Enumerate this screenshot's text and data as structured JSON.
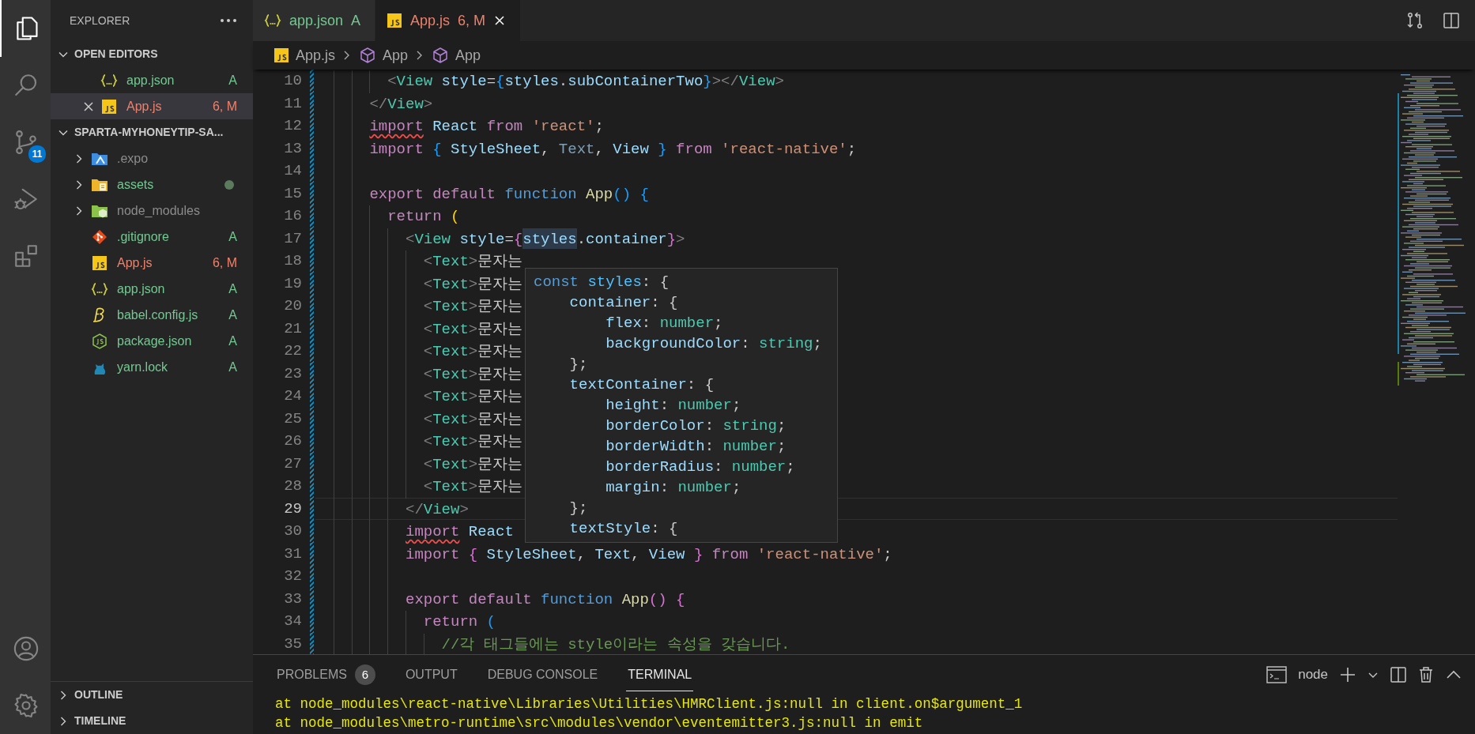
{
  "activity_bar": {
    "items": [
      {
        "kind": "explorer",
        "selected": true
      },
      {
        "kind": "search",
        "selected": false
      },
      {
        "kind": "source-control",
        "selected": false,
        "badge": "11"
      },
      {
        "kind": "run-debug",
        "selected": false
      },
      {
        "kind": "extensions",
        "selected": false
      }
    ],
    "bottom": [
      {
        "kind": "account"
      },
      {
        "kind": "settings"
      }
    ]
  },
  "sidebar": {
    "title": "EXPLORER",
    "open_editors": {
      "title": "OPEN EDITORS",
      "expanded": true,
      "items": [
        {
          "name": "app.json",
          "kind": "json",
          "color": "#73c991",
          "status": "A",
          "selected": false
        },
        {
          "name": "App.js",
          "kind": "js",
          "color": "#f0806a",
          "status": "6, M",
          "selected": true
        }
      ]
    },
    "folder": {
      "title": "SPARTA-MYHONEYTIP-SA...",
      "expanded": true,
      "items": [
        {
          "name": ".expo",
          "kind": "expo",
          "expanded": false,
          "color": "#8c8c8c"
        },
        {
          "name": "assets",
          "kind": "assets",
          "expanded": false,
          "color": "#73c991",
          "dot": true
        },
        {
          "name": "node_modules",
          "kind": "node",
          "expanded": false,
          "color": "#8c8c8c"
        },
        {
          "name": ".gitignore",
          "kind": "git",
          "color": "#73c991",
          "status": "A"
        },
        {
          "name": "App.js",
          "kind": "js",
          "color": "#f0806a",
          "status": "6, M"
        },
        {
          "name": "app.json",
          "kind": "json",
          "color": "#73c991",
          "status": "A"
        },
        {
          "name": "babel.config.js",
          "kind": "babel",
          "color": "#73c991",
          "status": "A"
        },
        {
          "name": "package.json",
          "kind": "nodejs",
          "color": "#73c991",
          "status": "A"
        },
        {
          "name": "yarn.lock",
          "kind": "yarn",
          "color": "#73c991",
          "status": "A"
        }
      ]
    },
    "bottom_sections": [
      {
        "title": "OUTLINE",
        "expanded": false
      },
      {
        "title": "TIMELINE",
        "expanded": false
      }
    ]
  },
  "editor": {
    "tabs": [
      {
        "label": "app.json",
        "kind": "json",
        "color": "#73c991",
        "status": "A",
        "selected": false
      },
      {
        "label": "App.js",
        "kind": "js",
        "color": "#f0806a",
        "status": "6, M",
        "selected": true
      }
    ],
    "breadcrumb": [
      {
        "label": "App.js",
        "kind": "js"
      },
      {
        "label": "App",
        "kind": "symbol"
      },
      {
        "label": "App",
        "kind": "symbol"
      }
    ],
    "lines": [
      {
        "number": "10",
        "current": false,
        "changed": true,
        "code": [
          {
            "text": "        <",
            "kind": "punct"
          },
          {
            "text": "View",
            "kind": "tag"
          },
          {
            "text": " style",
            "kind": "attr"
          },
          {
            "text": "=",
            "kind": "plain"
          },
          {
            "text": "{",
            "kind": "b3"
          },
          {
            "text": "styles",
            "kind": "var"
          },
          {
            "text": ".",
            "kind": "plain"
          },
          {
            "text": "subContainerTwo",
            "kind": "var"
          },
          {
            "text": "}",
            "kind": "b3"
          },
          {
            "text": "></",
            "kind": "punct"
          },
          {
            "text": "View",
            "kind": "tag"
          },
          {
            "text": ">",
            "kind": "punct"
          }
        ]
      },
      {
        "number": "11",
        "current": false,
        "changed": true,
        "code": [
          {
            "text": "      </",
            "kind": "punct"
          },
          {
            "text": "View",
            "kind": "tag"
          },
          {
            "text": ">",
            "kind": "punct"
          }
        ]
      },
      {
        "number": "12",
        "current": false,
        "changed": true,
        "code": [
          {
            "text": "      import",
            "kind": "kw-error"
          },
          {
            "text": " React",
            "kind": "var"
          },
          {
            "text": " from",
            "kind": "kw"
          },
          {
            "text": " 'react'",
            "kind": "str"
          },
          {
            "text": ";",
            "kind": "plain"
          }
        ]
      },
      {
        "number": "13",
        "current": false,
        "changed": true,
        "code": [
          {
            "text": "      import",
            "kind": "kw"
          },
          {
            "text": " {",
            "kind": "b3"
          },
          {
            "text": " StyleSheet",
            "kind": "var"
          },
          {
            "text": ",",
            "kind": "plain"
          },
          {
            "text": " Text",
            "kind": "dim"
          },
          {
            "text": ",",
            "kind": "plain"
          },
          {
            "text": " View",
            "kind": "var"
          },
          {
            "text": " }",
            "kind": "b3"
          },
          {
            "text": " from",
            "kind": "kw"
          },
          {
            "text": " 'react-native'",
            "kind": "str"
          },
          {
            "text": ";",
            "kind": "plain"
          }
        ]
      },
      {
        "number": "14",
        "current": false,
        "changed": true
      },
      {
        "number": "15",
        "current": false,
        "changed": true,
        "code": [
          {
            "text": "      export default",
            "kind": "kw"
          },
          {
            "text": " function",
            "kind": "storage"
          },
          {
            "text": " App",
            "kind": "fn"
          },
          {
            "text": "()",
            "kind": "b3"
          },
          {
            "text": " {",
            "kind": "b3"
          }
        ]
      },
      {
        "number": "16",
        "current": false,
        "changed": true,
        "code": [
          {
            "text": "        return",
            "kind": "kw"
          },
          {
            "text": " (",
            "kind": "b1"
          }
        ]
      },
      {
        "number": "17",
        "current": false,
        "changed": true,
        "code": [
          {
            "text": "          <",
            "kind": "punct"
          },
          {
            "text": "View",
            "kind": "tag"
          },
          {
            "text": " style",
            "kind": "attr"
          },
          {
            "text": "=",
            "kind": "plain"
          },
          {
            "text": "{",
            "kind": "b2"
          },
          {
            "text": "styles",
            "kind": "var-hover"
          },
          {
            "text": ".",
            "kind": "plain"
          },
          {
            "text": "container",
            "kind": "var"
          },
          {
            "text": "}",
            "kind": "b2"
          },
          {
            "text": ">",
            "kind": "punct"
          }
        ]
      },
      {
        "number": "18",
        "current": false,
        "changed": true,
        "code": [
          {
            "text": "            <",
            "kind": "punct"
          },
          {
            "text": "Text",
            "kind": "tag"
          },
          {
            "text": ">",
            "kind": "punct"
          },
          {
            "text": "문자는",
            "kind": "plain"
          }
        ]
      },
      {
        "number": "19",
        "current": false,
        "changed": true,
        "code": [
          {
            "text": "            <",
            "kind": "punct"
          },
          {
            "text": "Text",
            "kind": "tag"
          },
          {
            "text": ">",
            "kind": "punct"
          },
          {
            "text": "문자는",
            "kind": "plain"
          }
        ]
      },
      {
        "number": "20",
        "current": false,
        "changed": true,
        "code": [
          {
            "text": "            <",
            "kind": "punct"
          },
          {
            "text": "Text",
            "kind": "tag"
          },
          {
            "text": ">",
            "kind": "punct"
          },
          {
            "text": "문자는",
            "kind": "plain"
          }
        ]
      },
      {
        "number": "21",
        "current": false,
        "changed": true,
        "code": [
          {
            "text": "            <",
            "kind": "punct"
          },
          {
            "text": "Text",
            "kind": "tag"
          },
          {
            "text": ">",
            "kind": "punct"
          },
          {
            "text": "문자는",
            "kind": "plain"
          }
        ]
      },
      {
        "number": "22",
        "current": false,
        "changed": true,
        "code": [
          {
            "text": "            <",
            "kind": "punct"
          },
          {
            "text": "Text",
            "kind": "tag"
          },
          {
            "text": ">",
            "kind": "punct"
          },
          {
            "text": "문자는",
            "kind": "plain"
          }
        ]
      },
      {
        "number": "23",
        "current": false,
        "changed": true,
        "code": [
          {
            "text": "            <",
            "kind": "punct"
          },
          {
            "text": "Text",
            "kind": "tag"
          },
          {
            "text": ">",
            "kind": "punct"
          },
          {
            "text": "문자는",
            "kind": "plain"
          }
        ]
      },
      {
        "number": "24",
        "current": false,
        "changed": true,
        "code": [
          {
            "text": "            <",
            "kind": "punct"
          },
          {
            "text": "Text",
            "kind": "tag"
          },
          {
            "text": ">",
            "kind": "punct"
          },
          {
            "text": "문자는",
            "kind": "plain"
          }
        ]
      },
      {
        "number": "25",
        "current": false,
        "changed": true,
        "code": [
          {
            "text": "            <",
            "kind": "punct"
          },
          {
            "text": "Text",
            "kind": "tag"
          },
          {
            "text": ">",
            "kind": "punct"
          },
          {
            "text": "문자는",
            "kind": "plain"
          }
        ]
      },
      {
        "number": "26",
        "current": false,
        "changed": true,
        "code": [
          {
            "text": "            <",
            "kind": "punct"
          },
          {
            "text": "Text",
            "kind": "tag"
          },
          {
            "text": ">",
            "kind": "punct"
          },
          {
            "text": "문자는",
            "kind": "plain"
          }
        ]
      },
      {
        "number": "27",
        "current": false,
        "changed": true,
        "code": [
          {
            "text": "            <",
            "kind": "punct"
          },
          {
            "text": "Text",
            "kind": "tag"
          },
          {
            "text": ">",
            "kind": "punct"
          },
          {
            "text": "문자는",
            "kind": "plain"
          }
        ]
      },
      {
        "number": "28",
        "current": false,
        "changed": true,
        "code": [
          {
            "text": "            <",
            "kind": "punct"
          },
          {
            "text": "Text",
            "kind": "tag"
          },
          {
            "text": ">",
            "kind": "punct"
          },
          {
            "text": "문자는",
            "kind": "plain"
          }
        ]
      },
      {
        "number": "29",
        "current": true,
        "changed": true,
        "code": [
          {
            "text": "          </",
            "kind": "punct"
          },
          {
            "text": "View",
            "kind": "tag"
          },
          {
            "text": ">",
            "kind": "punct"
          }
        ]
      },
      {
        "number": "30",
        "current": false,
        "changed": true,
        "code": [
          {
            "text": "          import",
            "kind": "kw-error"
          },
          {
            "text": " React",
            "kind": "var"
          }
        ]
      },
      {
        "number": "31",
        "current": false,
        "changed": true,
        "code": [
          {
            "text": "          import",
            "kind": "kw"
          },
          {
            "text": " {",
            "kind": "b2"
          },
          {
            "text": " StyleSheet",
            "kind": "var"
          },
          {
            "text": ",",
            "kind": "plain"
          },
          {
            "text": " Text",
            "kind": "var"
          },
          {
            "text": ",",
            "kind": "plain"
          },
          {
            "text": " View",
            "kind": "var"
          },
          {
            "text": " }",
            "kind": "b2"
          },
          {
            "text": " from",
            "kind": "kw"
          },
          {
            "text": " 'react-native'",
            "kind": "str"
          },
          {
            "text": ";",
            "kind": "plain"
          }
        ]
      },
      {
        "number": "32",
        "current": false,
        "changed": true
      },
      {
        "number": "33",
        "current": false,
        "changed": true,
        "code": [
          {
            "text": "          export default",
            "kind": "kw"
          },
          {
            "text": " function",
            "kind": "storage"
          },
          {
            "text": " App",
            "kind": "fn"
          },
          {
            "text": "()",
            "kind": "b2"
          },
          {
            "text": " {",
            "kind": "b2"
          }
        ]
      },
      {
        "number": "34",
        "current": false,
        "changed": true,
        "code": [
          {
            "text": "            return",
            "kind": "kw"
          },
          {
            "text": " (",
            "kind": "b3"
          }
        ]
      },
      {
        "number": "35",
        "current": false,
        "changed": true,
        "code": [
          {
            "text": "              //각 태그들에는 style이라는 속성을 갖습니다.",
            "kind": "comment"
          }
        ]
      }
    ],
    "hover": {
      "lines": [
        {
          "code": [
            {
              "text": "const",
              "kind": "storage"
            },
            {
              "text": " styles",
              "kind": "const"
            },
            {
              "text": ": {",
              "kind": "plain"
            }
          ]
        },
        {
          "code": [
            {
              "text": "    container",
              "kind": "var"
            },
            {
              "text": ": {",
              "kind": "plain"
            }
          ]
        },
        {
          "code": [
            {
              "text": "        flex",
              "kind": "var"
            },
            {
              "text": ":",
              "kind": "plain"
            },
            {
              "text": " number",
              "kind": "type"
            },
            {
              "text": ";",
              "kind": "plain"
            }
          ]
        },
        {
          "code": [
            {
              "text": "        backgroundColor",
              "kind": "var"
            },
            {
              "text": ":",
              "kind": "plain"
            },
            {
              "text": " string",
              "kind": "type"
            },
            {
              "text": ";",
              "kind": "plain"
            }
          ]
        },
        {
          "code": [
            {
              "text": "    };",
              "kind": "plain"
            }
          ]
        },
        {
          "code": [
            {
              "text": "    textContainer",
              "kind": "var"
            },
            {
              "text": ": {",
              "kind": "plain"
            }
          ]
        },
        {
          "code": [
            {
              "text": "        height",
              "kind": "var"
            },
            {
              "text": ":",
              "kind": "plain"
            },
            {
              "text": " number",
              "kind": "type"
            },
            {
              "text": ";",
              "kind": "plain"
            }
          ]
        },
        {
          "code": [
            {
              "text": "        borderColor",
              "kind": "var"
            },
            {
              "text": ":",
              "kind": "plain"
            },
            {
              "text": " string",
              "kind": "type"
            },
            {
              "text": ";",
              "kind": "plain"
            }
          ]
        },
        {
          "code": [
            {
              "text": "        borderWidth",
              "kind": "var"
            },
            {
              "text": ":",
              "kind": "plain"
            },
            {
              "text": " number",
              "kind": "type"
            },
            {
              "text": ";",
              "kind": "plain"
            }
          ]
        },
        {
          "code": [
            {
              "text": "        borderRadius",
              "kind": "var"
            },
            {
              "text": ":",
              "kind": "plain"
            },
            {
              "text": " number",
              "kind": "type"
            },
            {
              "text": ";",
              "kind": "plain"
            }
          ]
        },
        {
          "code": [
            {
              "text": "        margin",
              "kind": "var"
            },
            {
              "text": ":",
              "kind": "plain"
            },
            {
              "text": " number",
              "kind": "type"
            },
            {
              "text": ";",
              "kind": "plain"
            }
          ]
        },
        {
          "code": [
            {
              "text": "    };",
              "kind": "plain"
            }
          ]
        },
        {
          "code": [
            {
              "text": "    textStyle",
              "kind": "var"
            },
            {
              "text": ": {",
              "kind": "plain"
            }
          ]
        }
      ]
    }
  },
  "panel": {
    "tabs": [
      {
        "label": "PROBLEMS",
        "count": "6",
        "selected": false
      },
      {
        "label": "OUTPUT",
        "selected": false
      },
      {
        "label": "DEBUG CONSOLE",
        "selected": false
      },
      {
        "label": "TERMINAL",
        "selected": true
      }
    ],
    "shell": "node",
    "terminal_lines": [
      "at node_modules\\react-native\\Libraries\\Utilities\\HMRClient.js:null in client.on$argument_1",
      "at node_modules\\metro-runtime\\src\\modules\\vendor\\eventemitter3.js:null in emit"
    ]
  }
}
